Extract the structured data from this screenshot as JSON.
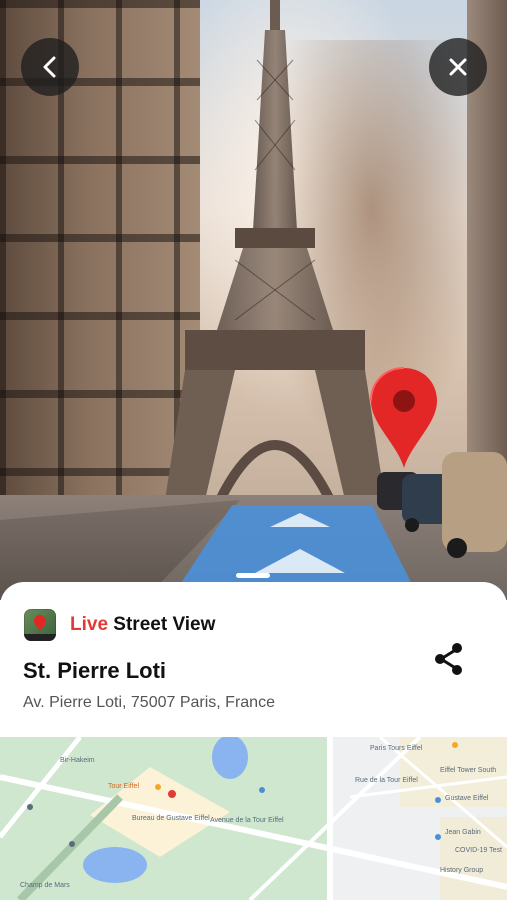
{
  "nav": {
    "back_icon": "chevron-left-icon",
    "close_icon": "close-icon"
  },
  "app": {
    "name_accent": "Live",
    "name_rest": " Street View",
    "accent_color": "#e53935"
  },
  "place": {
    "title": "St. Pierre Loti",
    "address": "Av. Pierre Loti, 75007 Paris, France"
  },
  "share_icon": "share-icon",
  "map": {
    "labels": {
      "tour_eiffel": "Tour Eiffel",
      "bureau": "Bureau de Gustave Eiffel",
      "avenue": "Avenue de la Tour Eiffel",
      "champ": "Champ de Mars",
      "bir_hakeim": "Bir-Hakeim",
      "paris_tours": "Paris Tours Eiffel",
      "eiffel_sud": "Eiffel Tower South",
      "gustave": "Gustave Eiffel",
      "jean_gabin": "Jean Gabin",
      "covid": "COVID-19 Test",
      "history": "History Group",
      "rue": "Rue de la Tour Eiffel"
    }
  }
}
